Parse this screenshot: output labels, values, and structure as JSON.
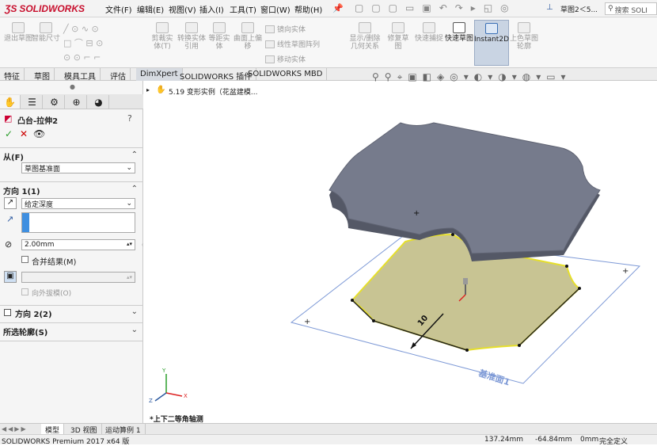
{
  "app": {
    "logo_text": "SOLIDWORKS",
    "window_title": "草图2＜5...",
    "search_placeholder": "搜索 SOLI"
  },
  "menu": [
    "文件(F)",
    "编辑(E)",
    "视图(V)",
    "插入(I)",
    "工具(T)",
    "窗口(W)",
    "帮助(H)"
  ],
  "ribbon": {
    "exit_sketch": "退出草图",
    "smart_dim": "智能尺寸",
    "trim": "剪裁实体(T)",
    "convert": "转换实体引用",
    "offset": "等距实体",
    "surface_offset": "曲面上偏移",
    "mirror": "镜向实体",
    "linear_pattern": "线性草图阵列",
    "move": "移动实体",
    "relations": "显示/删除几何关系",
    "repair": "修复草图",
    "quick_snap": "快速捕捉",
    "rapid_sketch": "快速草图",
    "instant2d": "Instant2D",
    "shaded": "上色草图轮廓"
  },
  "tabs": [
    "特征",
    "草图",
    "模具工具",
    "评估",
    "DimXpert",
    "SOLIDWORKS 插件",
    "SOLIDWORKS MBD"
  ],
  "panel": {
    "feature_title": "凸台-拉伸2",
    "from_label": "从(F)",
    "from_value": "草图基准面",
    "dir1_label": "方向 1(1)",
    "dir1_type": "给定深度",
    "depth": "2.00mm",
    "merge": "合并结果(M)",
    "draft_outward": "向外拔模(O)",
    "dir2_label": "方向 2(2)",
    "contours_label": "所选轮廓(S)"
  },
  "tree": {
    "item": "5.19 变形实例（花盆建模..."
  },
  "viewport": {
    "dim_value": "10",
    "plane_label": "基准面1",
    "view_label": "*上下二等角轴测"
  },
  "bottom_tabs": [
    "模型",
    "3D 视图",
    "运动算例 1"
  ],
  "status": {
    "product": "SOLIDWORKS Premium 2017 x64 版",
    "x": "137.24mm",
    "y": "-64.84mm",
    "z": "0mm",
    "state": "完全定义"
  },
  "colors": {
    "brand": "#c8102e",
    "plate_top": "#767b8c",
    "plate_side": "#545866",
    "sketch_fill": "#c8c493",
    "sketch_edge": "#e6df2a",
    "plane_edge": "#7d99d6"
  }
}
